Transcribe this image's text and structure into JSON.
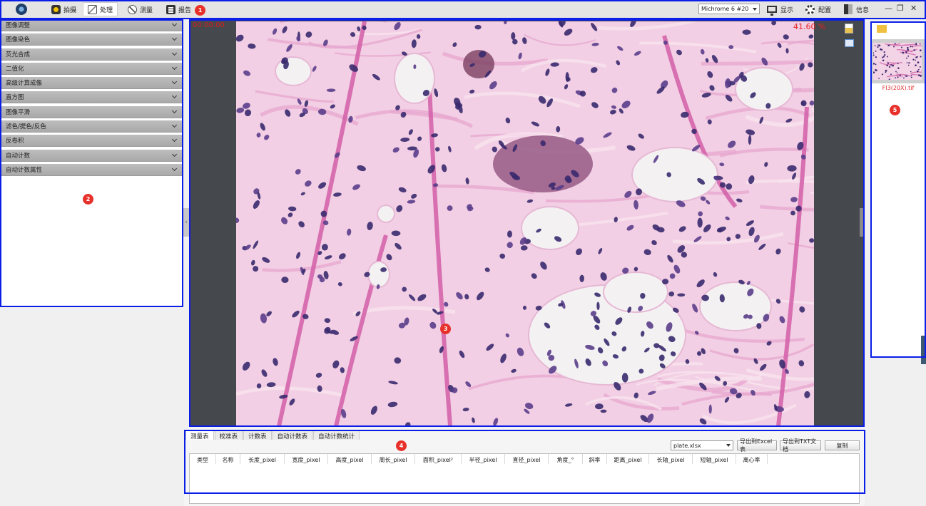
{
  "toolbar": {
    "nav": [
      {
        "label": "拍摄",
        "icon": "capture-icon"
      },
      {
        "label": "处理",
        "icon": "process-icon"
      },
      {
        "label": "测量",
        "icon": "measure-icon"
      },
      {
        "label": "报告",
        "icon": "report-icon"
      }
    ],
    "active_nav": "处理",
    "camera_select": "Michrome 6 #20",
    "display_label": "显示",
    "config_label": "配置",
    "info_label": "信息",
    "window_controls": [
      "—",
      "❐",
      "✕"
    ]
  },
  "left_panel": {
    "items": [
      "图像调整",
      "图像染色",
      "荧光合成",
      "二值化",
      "高级计算成像",
      "直方图",
      "图像平滑",
      "滤色/提色/反色",
      "反卷积",
      "自动计数",
      "自动计数属性"
    ]
  },
  "viewer": {
    "zoom_left": "00:00:00",
    "zoom_right": "41.60 %"
  },
  "thumbnails": {
    "items": [
      {
        "name": "FI3(20X).tif"
      }
    ]
  },
  "bottom": {
    "tabs": [
      "测量表",
      "校准表",
      "计数表",
      "自动计数表",
      "自动计数统计"
    ],
    "active_tab": "测量表",
    "file_select": "plate.xlsx",
    "export_excel": "导出到Excel表",
    "export_txt": "导出到TXT文档",
    "copy": "复制",
    "columns": [
      "类型",
      "名称",
      "长度_pixel",
      "宽度_pixel",
      "高度_pixel",
      "周长_pixel",
      "面积_pixel²",
      "半径_pixel",
      "直径_pixel",
      "角度_°",
      "斜率",
      "距离_pixel",
      "长轴_pixel",
      "短轴_pixel",
      "离心率"
    ]
  },
  "badges": [
    "1",
    "2",
    "3",
    "4",
    "5"
  ],
  "colors": {
    "highlight": "#0a1ee8",
    "badge": "#e8302a",
    "zoom_text": "#e42222",
    "tissue_pink": "#f3d3e6",
    "nucleus": "#3a2a6e"
  }
}
